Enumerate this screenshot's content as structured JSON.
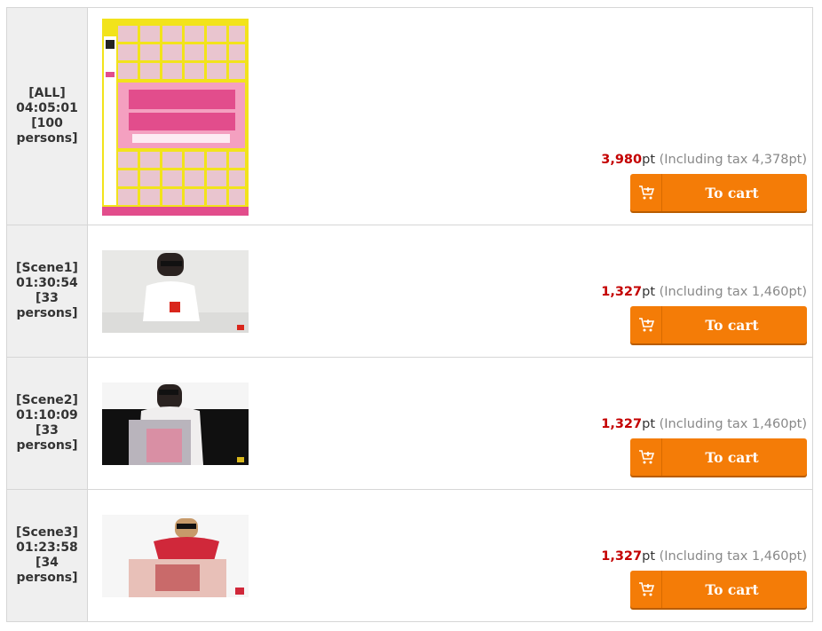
{
  "rows": [
    {
      "label": "[ALL]\n04:05:01\n[100\npersons]",
      "price": "3,980",
      "pt": "pt",
      "tax": "(Including tax 4,378pt)",
      "cart": "To cart",
      "thumb_kind": "cover",
      "thumb_colors": [
        "#f2e31b",
        "#f4a0c0",
        "#e24d8c"
      ]
    },
    {
      "label": "[Scene1]\n01:30:54\n[33\npersons]",
      "price": "1,327",
      "pt": "pt",
      "tax": "(Including tax 1,460pt)",
      "cart": "To cart",
      "thumb_kind": "scene",
      "thumb_colors": [
        "#e8e8e6",
        "#ffffff",
        "#d9261c"
      ]
    },
    {
      "label": "[Scene2]\n01:10:09\n[33\npersons]",
      "price": "1,327",
      "pt": "pt",
      "tax": "(Including tax 1,460pt)",
      "cart": "To cart",
      "thumb_kind": "scene",
      "thumb_colors": [
        "#101010",
        "#f0eeee",
        "#d98fa4"
      ]
    },
    {
      "label": "[Scene3]\n01:23:58\n[34\npersons]",
      "price": "1,327",
      "pt": "pt",
      "tax": "(Including tax 1,460pt)",
      "cart": "To cart",
      "thumb_kind": "scene",
      "thumb_colors": [
        "#f6f6f6",
        "#d0283a",
        "#e8b0a8"
      ]
    }
  ],
  "colors": {
    "accent": "#f47c07",
    "price": "#c40000"
  },
  "icons": {
    "cart": "cart-plus-icon"
  }
}
